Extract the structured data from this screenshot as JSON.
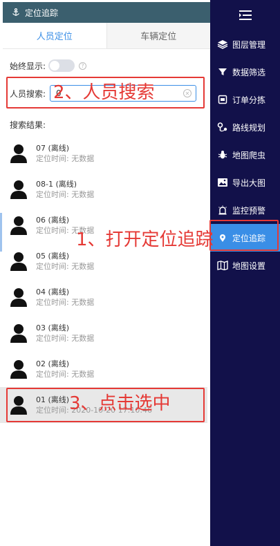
{
  "panel": {
    "title": "定位追踪",
    "tabs": [
      {
        "label": "人员定位",
        "active": true
      },
      {
        "label": "车辆定位",
        "active": false
      }
    ],
    "always_show_label": "始终显示:",
    "search_label": "人员搜索:",
    "search_value": "0",
    "results_label": "搜索结果:",
    "items": [
      {
        "name": "07 (离线)",
        "time": "定位时间:  无数据"
      },
      {
        "name": "08-1 (离线)",
        "time": "定位时间:  无数据"
      },
      {
        "name": "06 (离线)",
        "time": "定位时间:  无数据"
      },
      {
        "name": "05 (离线)",
        "time": "定位时间:  无数据"
      },
      {
        "name": "04 (离线)",
        "time": "定位时间:  无数据"
      },
      {
        "name": "03 (离线)",
        "time": "定位时间:  无数据"
      },
      {
        "name": "02 (离线)",
        "time": "定位时间:  无数据"
      },
      {
        "name": "01 (离线)",
        "time": "定位时间:  2020-10-20 17:10:46"
      }
    ]
  },
  "nav": {
    "items": [
      {
        "label": "图层管理",
        "icon": "layers-icon"
      },
      {
        "label": "数据筛选",
        "icon": "filter-icon"
      },
      {
        "label": "订单分拣",
        "icon": "order-icon"
      },
      {
        "label": "路线规划",
        "icon": "route-icon"
      },
      {
        "label": "地图爬虫",
        "icon": "bug-icon"
      },
      {
        "label": "导出大图",
        "icon": "image-icon"
      },
      {
        "label": "监控预警",
        "icon": "alarm-icon"
      },
      {
        "label": "定位追踪",
        "icon": "locate-icon",
        "active": true
      },
      {
        "label": "地图设置",
        "icon": "map-settings-icon"
      }
    ]
  },
  "annotations": {
    "step1": "1、打开定位追踪",
    "step2": "2、人员搜索",
    "step3": "3、点击选中"
  },
  "colors": {
    "header_bg": "#3b5f6e",
    "nav_bg": "#12114a",
    "accent": "#3a8ee6",
    "annotation": "#e53935"
  }
}
